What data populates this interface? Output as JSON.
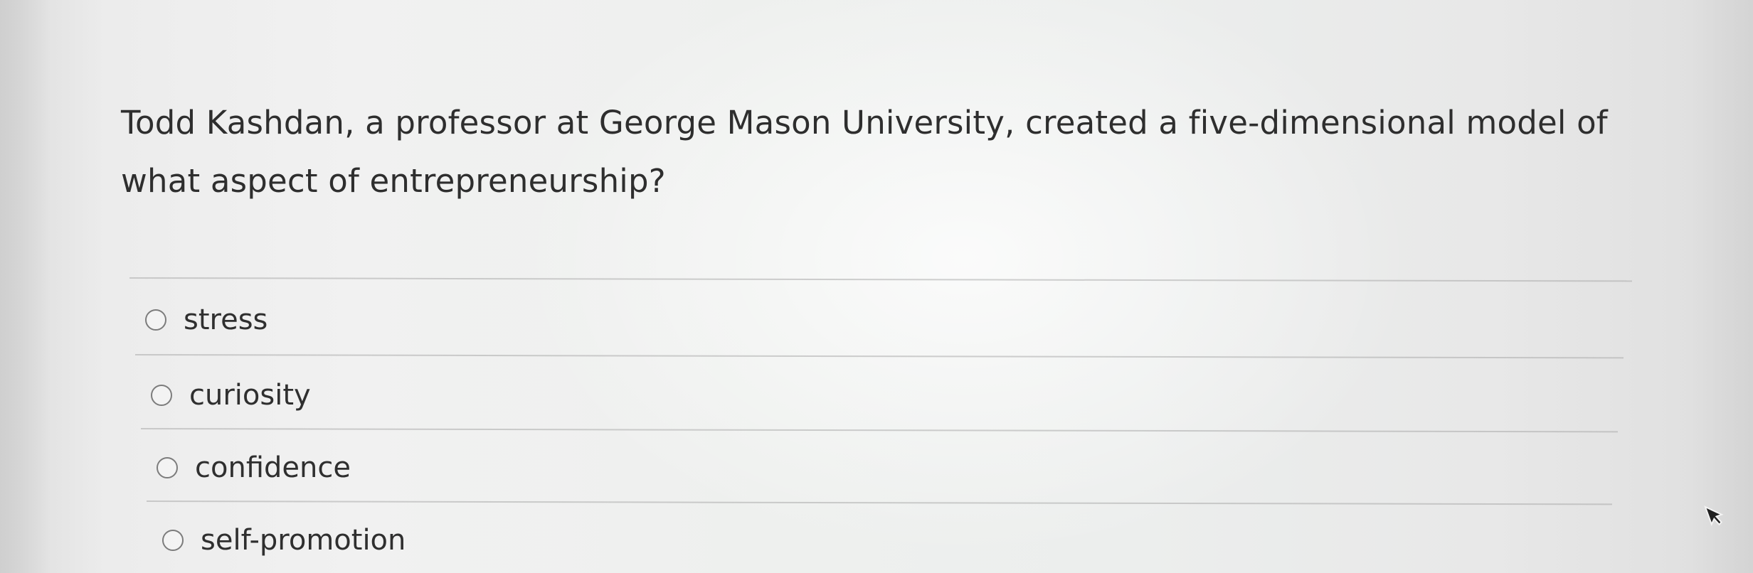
{
  "question": {
    "text_line1": "Todd Kashdan, a professor at George Mason University, created a five-dimensional model of",
    "text_line2": "what aspect of entrepreneurship?"
  },
  "options": [
    {
      "label": "stress",
      "selected": false
    },
    {
      "label": "curiosity",
      "selected": false
    },
    {
      "label": "confidence",
      "selected": false
    },
    {
      "label": "self-promotion",
      "selected": false
    }
  ],
  "cursor_icon": "mouse-pointer-icon"
}
